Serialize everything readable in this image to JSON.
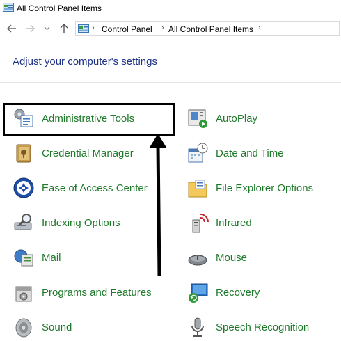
{
  "window": {
    "title": "All Control Panel Items"
  },
  "address_bar": {
    "crumbs": [
      "Control Panel",
      "All Control Panel Items"
    ]
  },
  "heading": "Adjust your computer's settings",
  "left_column": [
    {
      "label": "Administrative Tools",
      "icon": "administrative-tools-icon"
    },
    {
      "label": "Credential Manager",
      "icon": "credential-manager-icon"
    },
    {
      "label": "Ease of Access Center",
      "icon": "ease-of-access-icon"
    },
    {
      "label": "Indexing Options",
      "icon": "indexing-options-icon"
    },
    {
      "label": "Mail",
      "icon": "mail-icon"
    },
    {
      "label": "Programs and Features",
      "icon": "programs-features-icon"
    },
    {
      "label": "Sound",
      "icon": "sound-icon"
    }
  ],
  "right_column": [
    {
      "label": "AutoPlay",
      "icon": "autoplay-icon"
    },
    {
      "label": "Date and Time",
      "icon": "date-time-icon"
    },
    {
      "label": "File Explorer Options",
      "icon": "file-explorer-options-icon"
    },
    {
      "label": "Infrared",
      "icon": "infrared-icon"
    },
    {
      "label": "Mouse",
      "icon": "mouse-icon"
    },
    {
      "label": "Recovery",
      "icon": "recovery-icon"
    },
    {
      "label": "Speech Recognition",
      "icon": "speech-recognition-icon"
    }
  ],
  "colors": {
    "link": "#1e7a2a",
    "heading": "#1e3287",
    "highlight": "#000000"
  }
}
